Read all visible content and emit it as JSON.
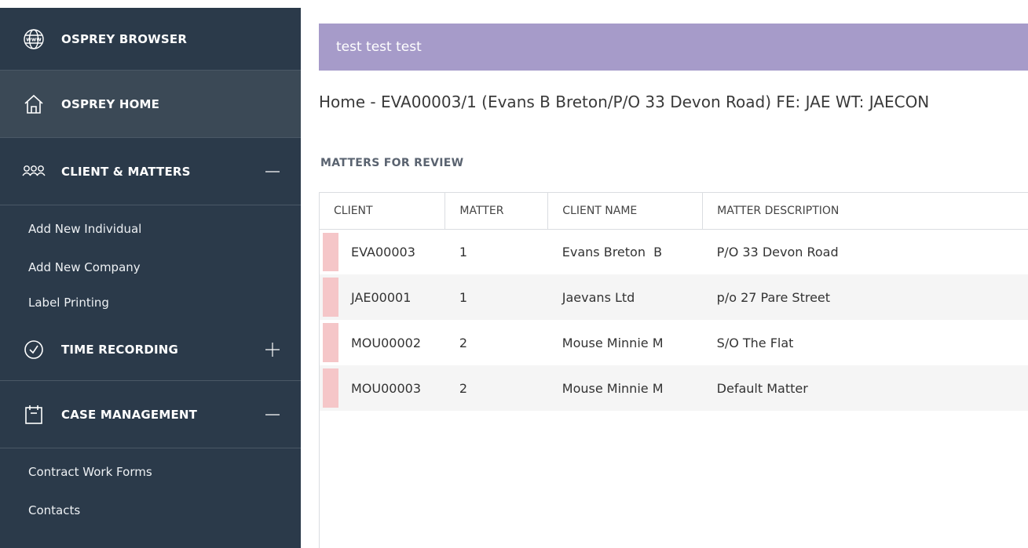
{
  "sidebar": {
    "browser": {
      "label": "OSPREY BROWSER",
      "icon": "globe-www-icon"
    },
    "home": {
      "label": "OSPREY HOME",
      "icon": "home-icon"
    },
    "clients": {
      "label": "CLIENT & MATTERS",
      "icon": "users-icon",
      "toggle": "—",
      "items": [
        "Add New Individual",
        "Add New Company",
        "Label Printing"
      ]
    },
    "time": {
      "label": "TIME RECORDING",
      "icon": "clock-icon",
      "toggle": "+"
    },
    "cases": {
      "label": "CASE MANAGEMENT",
      "icon": "calendar-icon",
      "toggle": "—",
      "items": [
        "Contract Work Forms",
        "Contacts"
      ]
    }
  },
  "banner": {
    "text": "test test test"
  },
  "page": {
    "title": "Home - EVA00003/1 (Evans B Breton/P/O 33 Devon Road) FE: JAE WT: JAECON",
    "section_title": "MATTERS FOR REVIEW"
  },
  "table": {
    "columns": [
      "CLIENT",
      "MATTER",
      "CLIENT NAME",
      "MATTER DESCRIPTION"
    ],
    "rows": [
      {
        "client": "EVA00003",
        "matter": "1",
        "client_name": "Evans Breton  B",
        "description": "P/O 33 Devon Road"
      },
      {
        "client": "JAE00001",
        "matter": "1",
        "client_name": "Jaevans Ltd",
        "description": "p/o 27 Pare Street"
      },
      {
        "client": "MOU00002",
        "matter": "2",
        "client_name": "Mouse Minnie M",
        "description": "S/O The Flat"
      },
      {
        "client": "MOU00003",
        "matter": "2",
        "client_name": "Mouse Minnie M",
        "description": "Default Matter"
      }
    ]
  },
  "colors": {
    "sidebar_bg": "#2b3a4a",
    "banner_bg": "#a69bc9",
    "row_flag": "#f5c6c8"
  }
}
